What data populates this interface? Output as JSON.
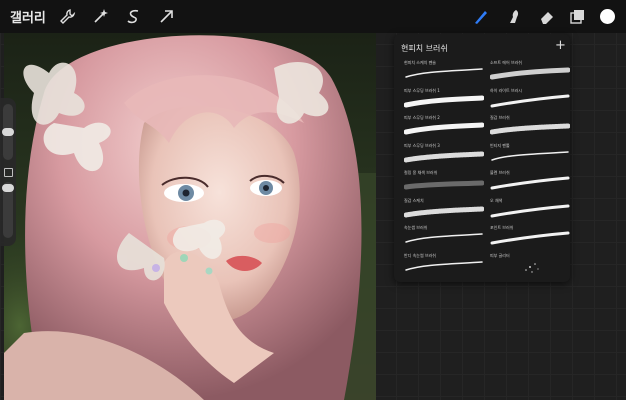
{
  "app": {
    "gallery_label": "갤러리"
  },
  "toolbar": {
    "left_icons": [
      "wrench-icon",
      "magic-wand-icon",
      "selection-icon",
      "transform-arrow-icon"
    ],
    "right_icons": [
      "brush-icon",
      "smudge-icon",
      "eraser-icon",
      "layers-icon"
    ],
    "active_tool": "brush",
    "accent_color": "#2f7cf6",
    "current_color": "#ffffff"
  },
  "brush_panel": {
    "title": "현피치 브러쉬",
    "add_label": "+",
    "brushes": [
      {
        "name": "현피치 스케치 펜슬",
        "style": "thin"
      },
      {
        "name": "소프트 에어 브러쉬",
        "style": "soft"
      },
      {
        "name": "피부 스무딩 브러쉬 1",
        "style": "bold"
      },
      {
        "name": "하이 라이트 브러시",
        "style": "taper"
      },
      {
        "name": "피부 스무딩 브러쉬 2",
        "style": "bold"
      },
      {
        "name": "질감 브러쉬",
        "style": "grain"
      },
      {
        "name": "피부 스무딩 브러쉬 3",
        "style": "grain"
      },
      {
        "name": "빈티지 펜툴",
        "style": "thin"
      },
      {
        "name": "컬링 몽 채색 브러쉬",
        "style": "dark"
      },
      {
        "name": "블렌 브러쉬",
        "style": "taper"
      },
      {
        "name": "질감 스케치",
        "style": "grain"
      },
      {
        "name": "오 채색",
        "style": "taper"
      },
      {
        "name": "속눈썹 브러쉬",
        "style": "thin"
      },
      {
        "name": "포인트 브러쉬",
        "style": "taper"
      },
      {
        "name": "반디 속눈썹 브러쉬",
        "style": "thin"
      },
      {
        "name": "피부 글리터",
        "style": "sparkle"
      }
    ]
  }
}
